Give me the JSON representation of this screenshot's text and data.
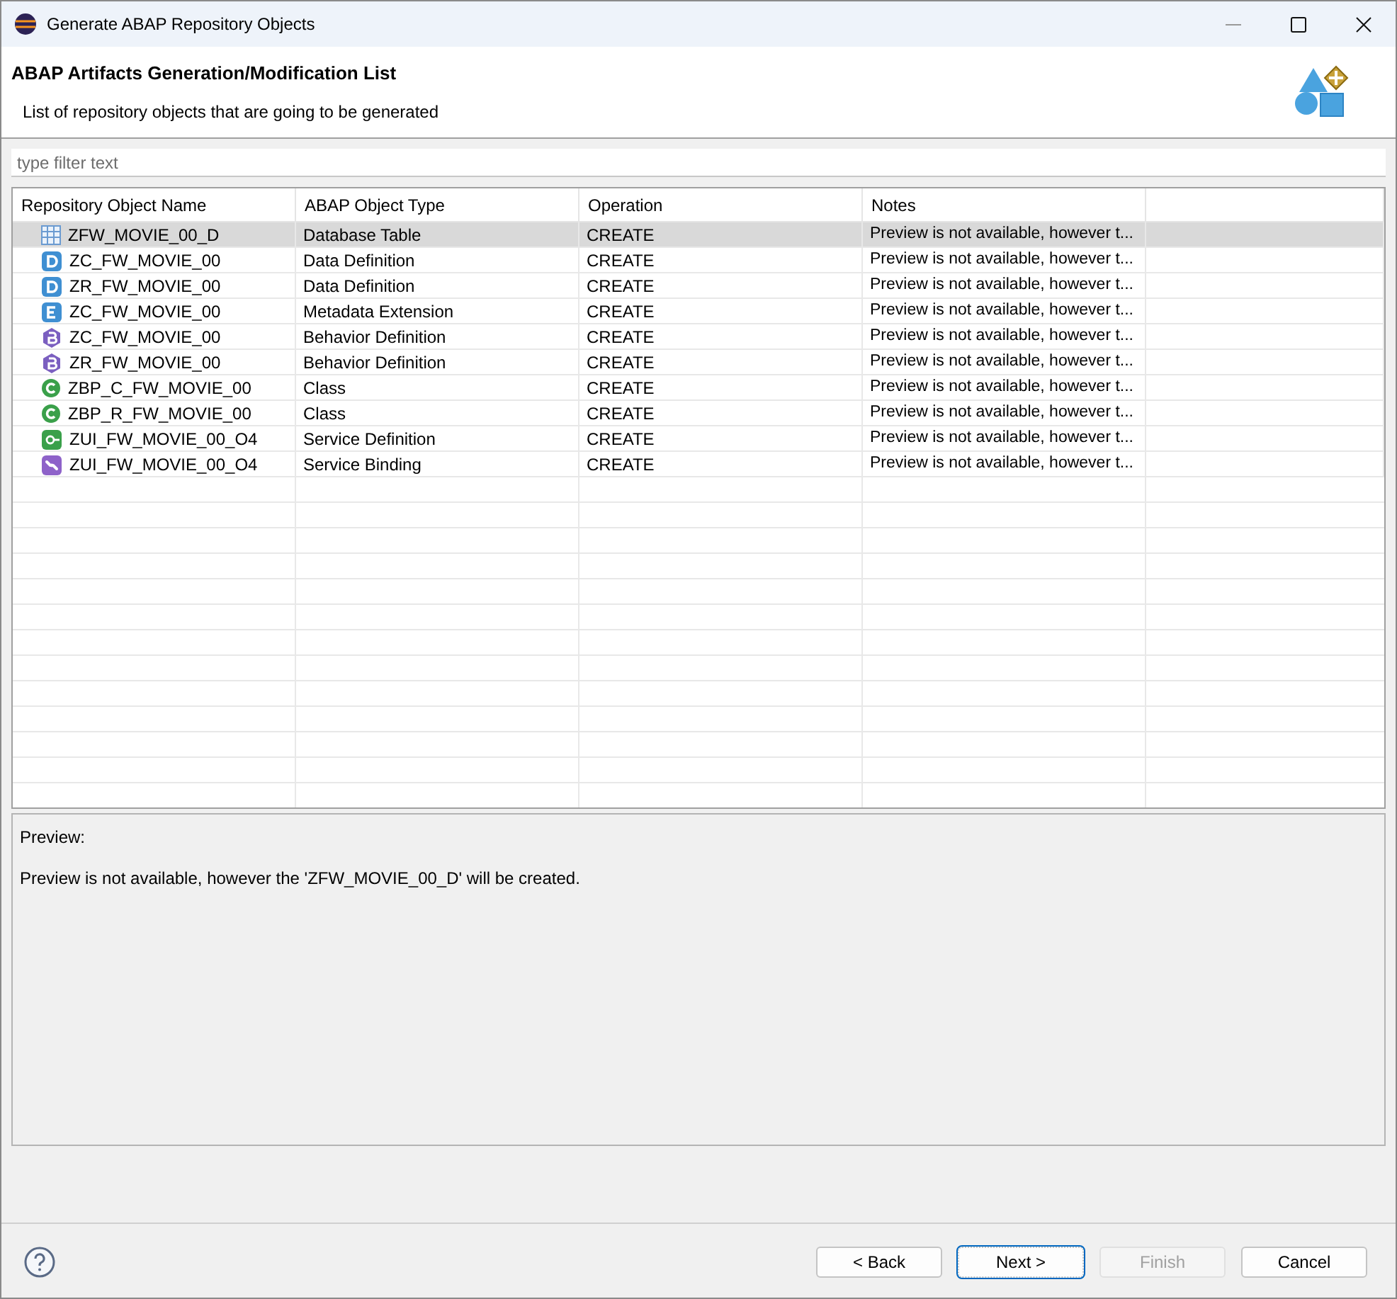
{
  "window": {
    "title": "Generate ABAP Repository Objects"
  },
  "header": {
    "title": "ABAP Artifacts Generation/Modification List",
    "subtitle": "List of repository objects that are going to be generated"
  },
  "filter": {
    "placeholder": "type filter text"
  },
  "table": {
    "columns": [
      "Repository Object Name",
      "ABAP Object Type",
      "Operation",
      "Notes"
    ],
    "rows": [
      {
        "kind": "table",
        "name": "ZFW_MOVIE_00_D",
        "type": "Database Table",
        "operation": "CREATE",
        "notes": "Preview is not available, however t...",
        "selected": true
      },
      {
        "kind": "data-definition",
        "name": "ZC_FW_MOVIE_00",
        "type": "Data Definition",
        "operation": "CREATE",
        "notes": "Preview is not available, however t...",
        "selected": false
      },
      {
        "kind": "data-definition",
        "name": "ZR_FW_MOVIE_00",
        "type": "Data Definition",
        "operation": "CREATE",
        "notes": "Preview is not available, however t...",
        "selected": false
      },
      {
        "kind": "metadata-extension",
        "name": "ZC_FW_MOVIE_00",
        "type": "Metadata Extension",
        "operation": "CREATE",
        "notes": "Preview is not available, however t...",
        "selected": false
      },
      {
        "kind": "behavior",
        "name": "ZC_FW_MOVIE_00",
        "type": "Behavior Definition",
        "operation": "CREATE",
        "notes": "Preview is not available, however t...",
        "selected": false
      },
      {
        "kind": "behavior",
        "name": "ZR_FW_MOVIE_00",
        "type": "Behavior Definition",
        "operation": "CREATE",
        "notes": "Preview is not available, however t...",
        "selected": false
      },
      {
        "kind": "class",
        "name": "ZBP_C_FW_MOVIE_00",
        "type": "Class",
        "operation": "CREATE",
        "notes": "Preview is not available, however t...",
        "selected": false
      },
      {
        "kind": "class",
        "name": "ZBP_R_FW_MOVIE_00",
        "type": "Class",
        "operation": "CREATE",
        "notes": "Preview is not available, however t...",
        "selected": false
      },
      {
        "kind": "service-definition",
        "name": "ZUI_FW_MOVIE_00_O4",
        "type": "Service Definition",
        "operation": "CREATE",
        "notes": "Preview is not available, however t...",
        "selected": false
      },
      {
        "kind": "service-binding",
        "name": "ZUI_FW_MOVIE_00_O4",
        "type": "Service Binding",
        "operation": "CREATE",
        "notes": "Preview is not available, however t...",
        "selected": false
      }
    ]
  },
  "preview": {
    "label": "Preview:",
    "text": "Preview is not available, however the 'ZFW_MOVIE_00_D' will be created."
  },
  "buttons": [
    {
      "label": "< Back",
      "disabled": false,
      "default": false
    },
    {
      "label": "Next >",
      "disabled": false,
      "default": true
    },
    {
      "label": "Finish",
      "disabled": true,
      "default": false
    },
    {
      "label": "Cancel",
      "disabled": false,
      "default": false
    }
  ]
}
